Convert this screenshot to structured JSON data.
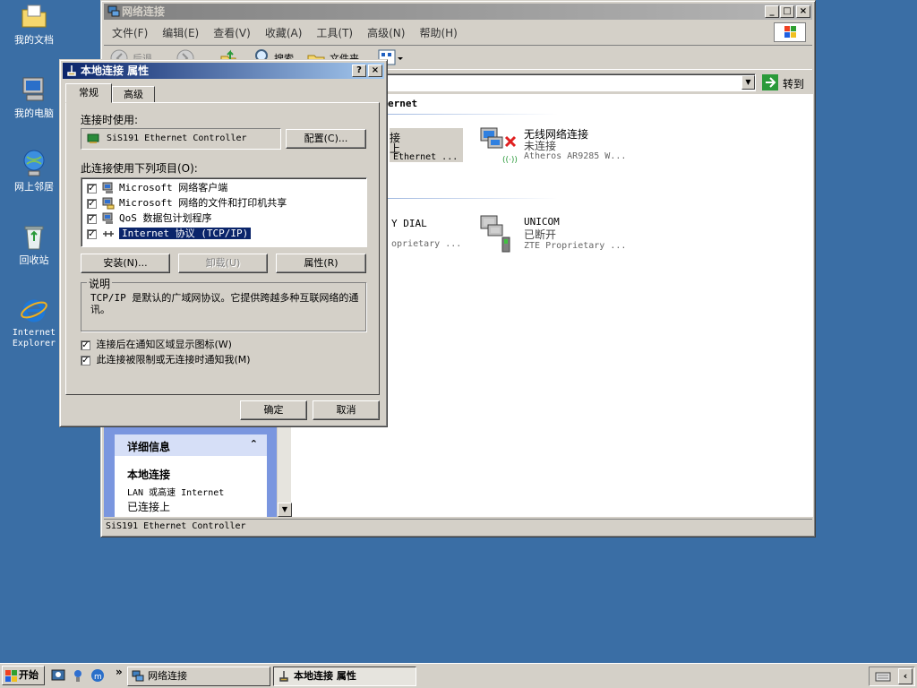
{
  "desktop": {
    "icons": [
      {
        "label": "我的文档",
        "icon": "folder-documents-icon"
      },
      {
        "label": "我的电脑",
        "icon": "computer-icon"
      },
      {
        "label": "网上邻居",
        "icon": "network-icon"
      },
      {
        "label": "回收站",
        "icon": "recycle-bin-icon"
      },
      {
        "label": "Internet Explorer",
        "icon": "ie-icon"
      }
    ]
  },
  "explorer": {
    "title": "网络连接",
    "menu": [
      "文件(F)",
      "编辑(E)",
      "查看(V)",
      "收藏(A)",
      "工具(T)",
      "高级(N)",
      "帮助(H)"
    ],
    "toolbar": {
      "back": "后退",
      "search": "搜索",
      "folders": "文件夹"
    },
    "go_label": "转到",
    "group_header": "ernet",
    "connections": [
      {
        "name_partial": "接",
        "status_partial": "上",
        "device_partial": "Ethernet ..."
      },
      {
        "name": "无线网络连接",
        "status": "未连接",
        "device": "Atheros AR9285 W..."
      },
      {
        "name_partial": "Y DIAL",
        "device_partial": "oprietary ..."
      },
      {
        "name": "UNICOM",
        "status": "已断开",
        "device": "ZTE Proprietary ..."
      }
    ],
    "details": {
      "header": "详细信息",
      "name": "本地连接",
      "type": "LAN 或高速 Internet",
      "status": "已连接上"
    },
    "statusbar": "SiS191 Ethernet Controller"
  },
  "dialog": {
    "title": "本地连接 属性",
    "tabs": [
      "常规",
      "高级"
    ],
    "connect_using_label": "连接时使用:",
    "adapter": "SiS191 Ethernet Controller",
    "configure_button": "配置(C)...",
    "items_label": "此连接使用下列项目(O):",
    "items": [
      {
        "label": "Microsoft 网络客户端",
        "checked": true
      },
      {
        "label": "Microsoft 网络的文件和打印机共享",
        "checked": true
      },
      {
        "label": "QoS 数据包计划程序",
        "checked": true
      },
      {
        "label": "Internet 协议 (TCP/IP)",
        "checked": true
      }
    ],
    "install_button": "安装(N)...",
    "uninstall_button": "卸载(U)",
    "properties_button": "属性(R)",
    "description_label": "说明",
    "description": "TCP/IP 是默认的广域网协议。它提供跨越多种互联网络的通讯。",
    "show_icon_label": "连接后在通知区域显示图标(W)",
    "notify_label": "此连接被限制或无连接时通知我(M)",
    "ok_button": "确定",
    "cancel_button": "取消"
  },
  "taskbar": {
    "start": "开始",
    "tasks": [
      "网络连接",
      "本地连接 属性"
    ]
  },
  "colors": {
    "desktop": "#3a6ea5",
    "active_title": "#0a246a",
    "selection": "#0a246a"
  }
}
